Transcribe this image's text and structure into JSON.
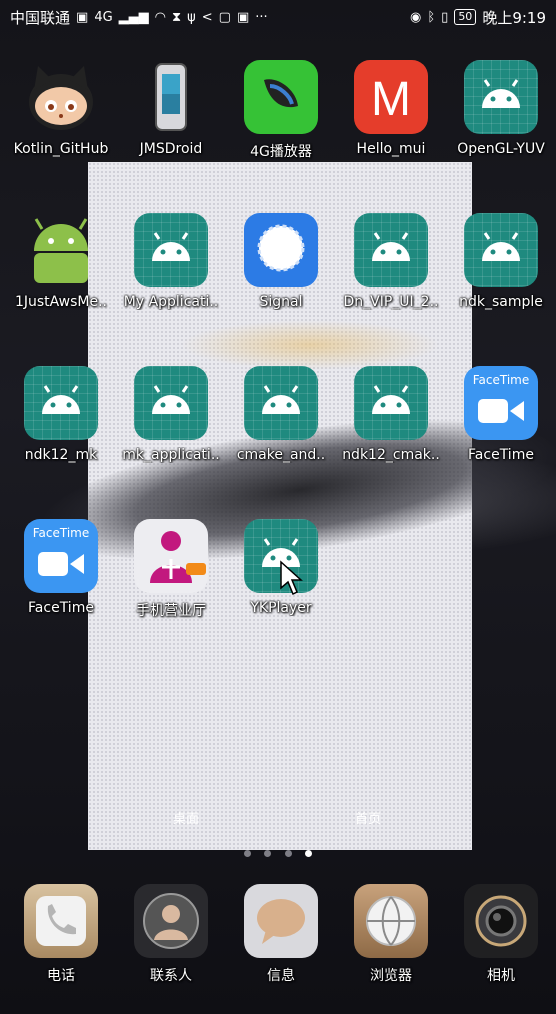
{
  "statusbar": {
    "carrier": "中国联通",
    "network": "4G",
    "time": "晚上9:19",
    "battery": "50"
  },
  "colors": {
    "android_teal": "#1f8a7f",
    "facetime_blue": "#3b96f2",
    "hello_red": "#e53d2b",
    "signal_blue": "#2c7be5"
  },
  "apps": [
    {
      "label": "Kotlin_GitHub",
      "icon": "github-octocat-icon"
    },
    {
      "label": "JMSDroid",
      "icon": "phone-device-icon"
    },
    {
      "label": "4G播放器",
      "icon": "player-icon"
    },
    {
      "label": "Hello_mui",
      "icon": "hello-m-icon"
    },
    {
      "label": "OpenGL-YUV",
      "icon": "android-icon"
    },
    {
      "label": "1JustAwsMe..",
      "icon": "android-robot-icon"
    },
    {
      "label": "My Applicati..",
      "icon": "android-icon"
    },
    {
      "label": "Signal",
      "icon": "signal-icon"
    },
    {
      "label": "Dn_VIP_UI_2..",
      "icon": "android-icon"
    },
    {
      "label": "ndk_sample",
      "icon": "android-icon"
    },
    {
      "label": "ndk12_mk",
      "icon": "android-icon"
    },
    {
      "label": "mk_applicati..",
      "icon": "android-icon"
    },
    {
      "label": "cmake_and..",
      "icon": "android-icon"
    },
    {
      "label": "ndk12_cmak..",
      "icon": "android-icon"
    },
    {
      "label": "FaceTime",
      "icon": "facetime-icon",
      "badge": "FaceTime"
    },
    {
      "label": "FaceTime",
      "icon": "facetime-icon",
      "badge": "FaceTime"
    },
    {
      "label": "手机营业厅",
      "icon": "unicom-icon"
    },
    {
      "label": "YKPlayer",
      "icon": "android-icon"
    }
  ],
  "pane_labels": {
    "left": "桌面",
    "right": "首页"
  },
  "page_indicator": {
    "count": 4,
    "active": 3
  },
  "dock": [
    {
      "label": "电话",
      "icon": "phone-icon"
    },
    {
      "label": "联系人",
      "icon": "contacts-icon"
    },
    {
      "label": "信息",
      "icon": "messages-icon"
    },
    {
      "label": "浏览器",
      "icon": "browser-icon"
    },
    {
      "label": "相机",
      "icon": "camera-icon"
    }
  ]
}
